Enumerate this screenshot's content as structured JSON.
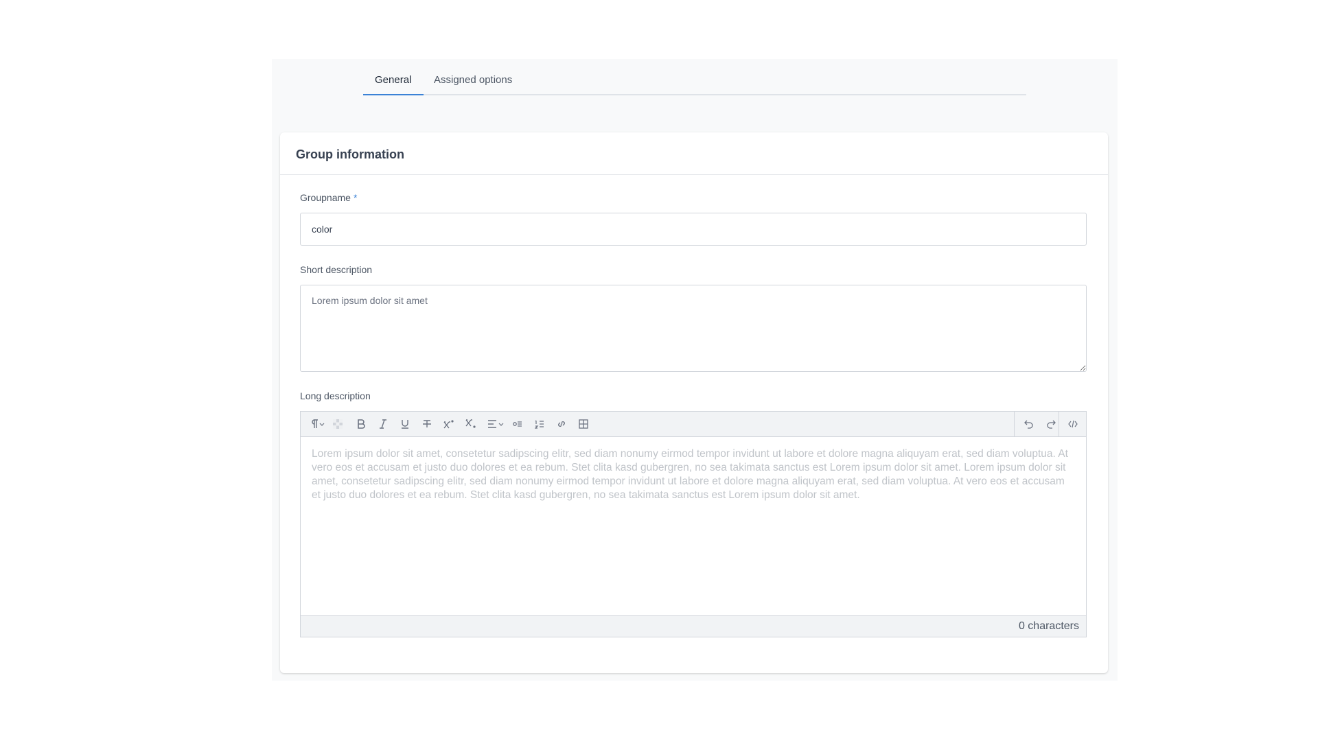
{
  "tabs": [
    {
      "label": "General",
      "active": true
    },
    {
      "label": "Assigned options",
      "active": false
    }
  ],
  "card": {
    "title": "Group information"
  },
  "groupname": {
    "label": "Groupname",
    "required_marker": "*",
    "value": "color"
  },
  "short_description": {
    "label": "Short description",
    "placeholder": "Lorem ipsum dolor sit amet",
    "value": ""
  },
  "long_description": {
    "label": "Long description",
    "placeholder": "Lorem ipsum dolor sit amet, consetetur sadipscing elitr, sed diam nonumy eirmod tempor invidunt ut labore et dolore magna aliquyam erat, sed diam voluptua. At vero eos et accusam et justo duo dolores et ea rebum. Stet clita kasd gubergren, no sea takimata sanctus est Lorem ipsum dolor sit amet. Lorem ipsum dolor sit amet, consetetur sadipscing elitr, sed diam nonumy eirmod tempor invidunt ut labore et dolore magna aliquyam erat, sed diam voluptua. At vero eos et accusam et justo duo dolores et ea rebum. Stet clita kasd gubergren, no sea takimata sanctus est Lorem ipsum dolor sit amet.",
    "char_count": "0 characters",
    "toolbar_left": [
      "paragraph-format-icon",
      "clear-format-icon",
      "bold-icon",
      "italic-icon",
      "underline-icon",
      "strikethrough-icon",
      "superscript-icon",
      "subscript-icon",
      "align-icon",
      "bullet-list-icon",
      "numbered-list-icon",
      "link-icon",
      "table-icon"
    ],
    "toolbar_right": [
      "undo-icon",
      "redo-icon",
      "code-view-icon"
    ]
  },
  "colors": {
    "accent": "#3b82d6",
    "panel_bg": "#f8f9fa",
    "toolbar_bg": "#f1f3f5"
  }
}
